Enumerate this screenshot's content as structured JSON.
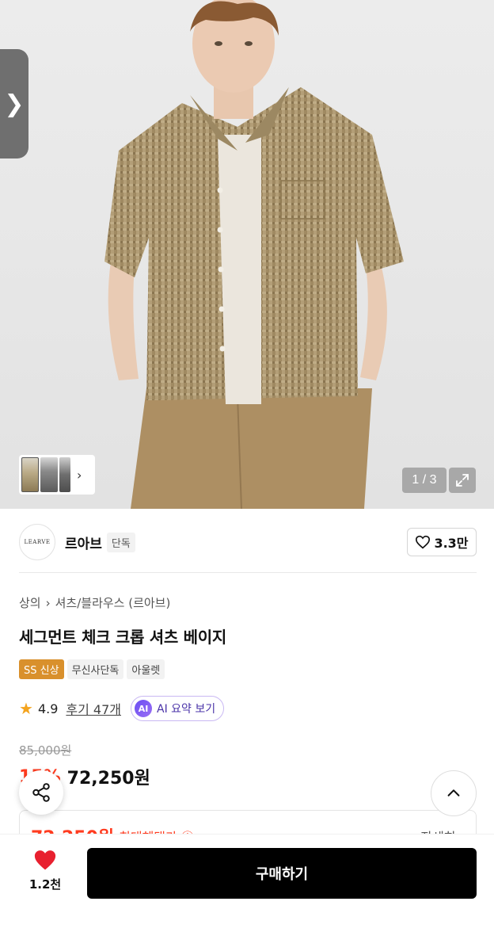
{
  "gallery": {
    "counter": "1 / 3",
    "side_tab_icon": "chevron-right-icon",
    "thumb_arrow": "›"
  },
  "brand": {
    "logo_text": "LEARVE",
    "name": "르아브",
    "badge": "단독",
    "likes": "3.3만"
  },
  "product": {
    "breadcrumb": [
      "상의",
      "셔츠/블라우스 (르아브)"
    ],
    "title": "세그먼트 체크 크롭 셔츠 베이지",
    "tags": [
      "SS 신상",
      "무신사단독",
      "아울렛"
    ],
    "rating": "4.9",
    "reviews": "후기 47개",
    "ai_summary": "AI 요약 보기",
    "ai_badge": "AI"
  },
  "price": {
    "original": "85,000원",
    "discount": "15%",
    "sale": "72,250원",
    "benefit_price": "72,250원",
    "benefit_label": "최대혜택가 ⓘ",
    "benefit_more": "자세히 ›"
  },
  "bottom": {
    "wish_count": "1.2천",
    "buy_label": "구매하기"
  },
  "colors": {
    "accent_red": "#ff3b1f",
    "ss_tag": "#d9902c",
    "ai_purple": "#6a4df2",
    "heart": "#e8202f"
  }
}
